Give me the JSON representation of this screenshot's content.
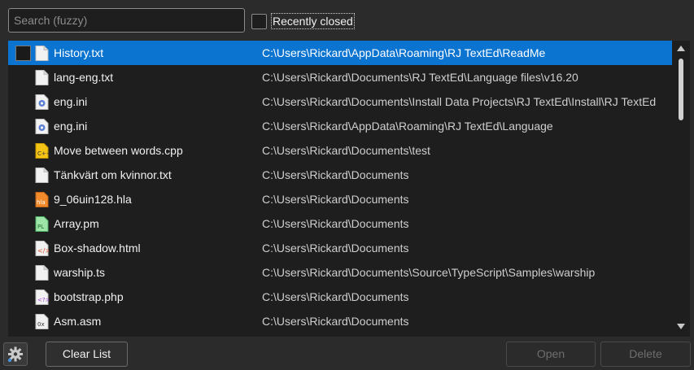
{
  "search": {
    "placeholder": "Search (fuzzy)",
    "value": ""
  },
  "recently_closed": {
    "label": "Recently closed",
    "checked": false
  },
  "files": [
    {
      "name": "History.txt",
      "path": "C:\\Users\\Rickard\\AppData\\Roaming\\RJ TextEd\\ReadMe",
      "icon": "text-file-icon",
      "selected": true
    },
    {
      "name": "lang-eng.txt",
      "path": "C:\\Users\\Rickard\\Documents\\RJ TextEd\\Language files\\v16.20",
      "icon": "text-file-icon"
    },
    {
      "name": "eng.ini",
      "path": "C:\\Users\\Rickard\\Documents\\Install Data Projects\\RJ TextEd\\Install\\RJ TextEd",
      "icon": "ini-file-icon"
    },
    {
      "name": "eng.ini",
      "path": "C:\\Users\\Rickard\\AppData\\Roaming\\RJ TextEd\\Language",
      "icon": "ini-file-icon"
    },
    {
      "name": "Move between words.cpp",
      "path": "C:\\Users\\Rickard\\Documents\\test",
      "icon": "cpp-file-icon"
    },
    {
      "name": "Tänkvärt om kvinnor.txt",
      "path": "C:\\Users\\Rickard\\Documents",
      "icon": "text-file-icon"
    },
    {
      "name": "9_06uin128.hla",
      "path": "C:\\Users\\Rickard\\Documents",
      "icon": "hla-file-icon"
    },
    {
      "name": "Array.pm",
      "path": "C:\\Users\\Rickard\\Documents",
      "icon": "perl-file-icon"
    },
    {
      "name": "Box-shadow.html",
      "path": "C:\\Users\\Rickard\\Documents",
      "icon": "html-file-icon"
    },
    {
      "name": "warship.ts",
      "path": "C:\\Users\\Rickard\\Documents\\Source\\TypeScript\\Samples\\warship",
      "icon": "ts-file-icon"
    },
    {
      "name": "bootstrap.php",
      "path": "C:\\Users\\Rickard\\Documents",
      "icon": "php-file-icon"
    },
    {
      "name": "Asm.asm",
      "path": "C:\\Users\\Rickard\\Documents",
      "icon": "asm-file-icon"
    }
  ],
  "toolbar": {
    "settings_icon": "gear-icon",
    "clear_label": "Clear List",
    "open_label": "Open",
    "delete_label": "Delete"
  },
  "colors": {
    "selection": "#0b74d1",
    "background": "#2b2b2b",
    "list_background": "#1e1e1e"
  }
}
